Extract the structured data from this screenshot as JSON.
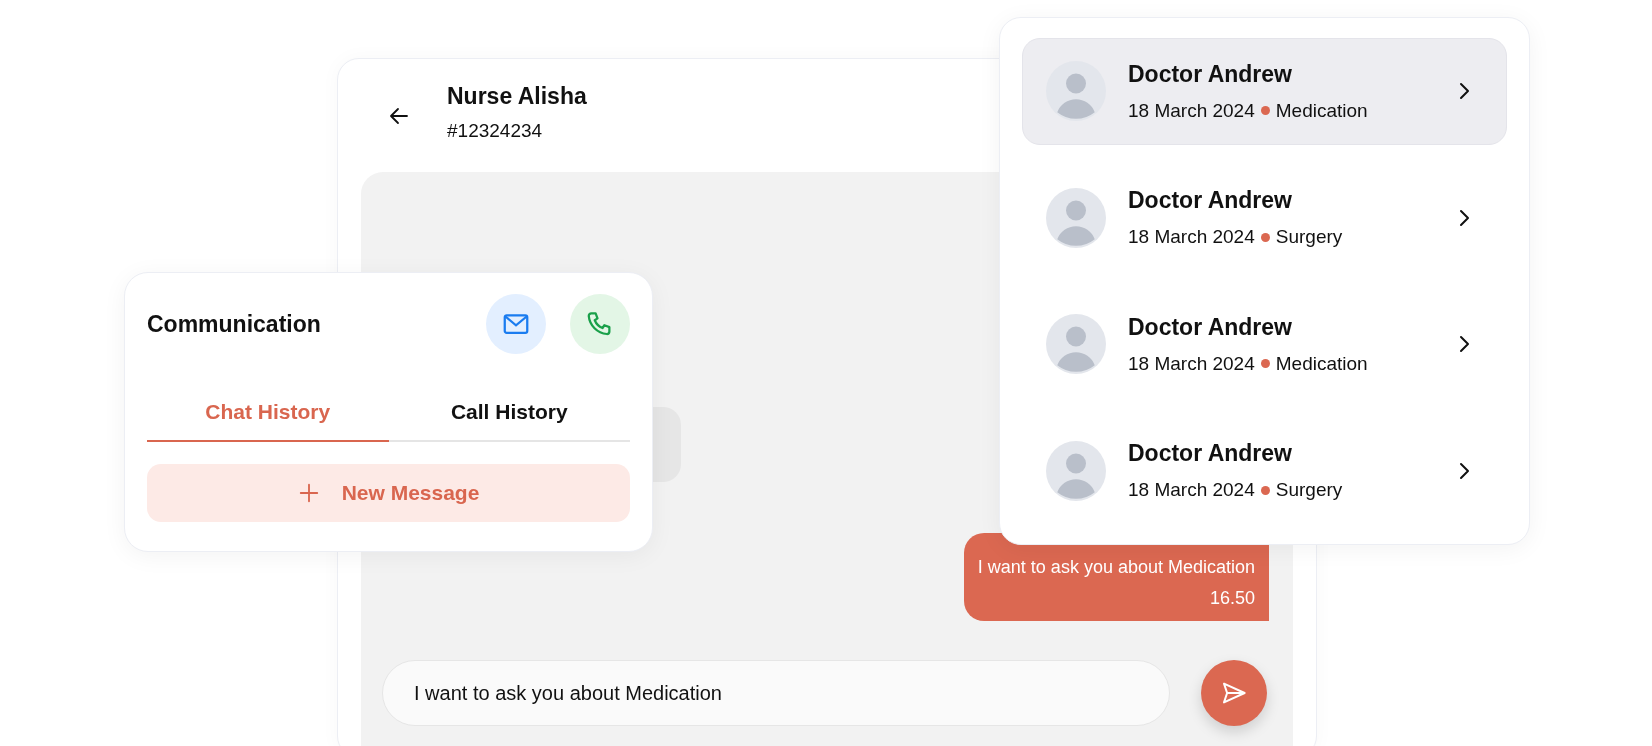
{
  "chat": {
    "contact": {
      "name": "Nurse Alisha",
      "id": "#12324234"
    },
    "messages": [
      {
        "kind": "outgoing",
        "text": "I want to ask you about Medication",
        "time": "16.50"
      }
    ],
    "composer": {
      "value": "I want to ask you about Medication"
    }
  },
  "communication": {
    "title": "Communication",
    "tabs": [
      {
        "label": "Chat History",
        "selected": true
      },
      {
        "label": "Call History",
        "selected": false
      }
    ],
    "new_message_button": "New Message"
  },
  "consultations": [
    {
      "doctor": "Doctor Andrew",
      "date": "18 March 2024",
      "topic": "Medication",
      "selected": true
    },
    {
      "doctor": "Doctor Andrew",
      "date": "18 March 2024",
      "topic": "Surgery",
      "selected": false
    },
    {
      "doctor": "Doctor Andrew",
      "date": "18 March 2024",
      "topic": "Medication",
      "selected": false
    },
    {
      "doctor": "Doctor Andrew",
      "date": "18 March 2024",
      "topic": "Surgery",
      "selected": false
    }
  ]
}
